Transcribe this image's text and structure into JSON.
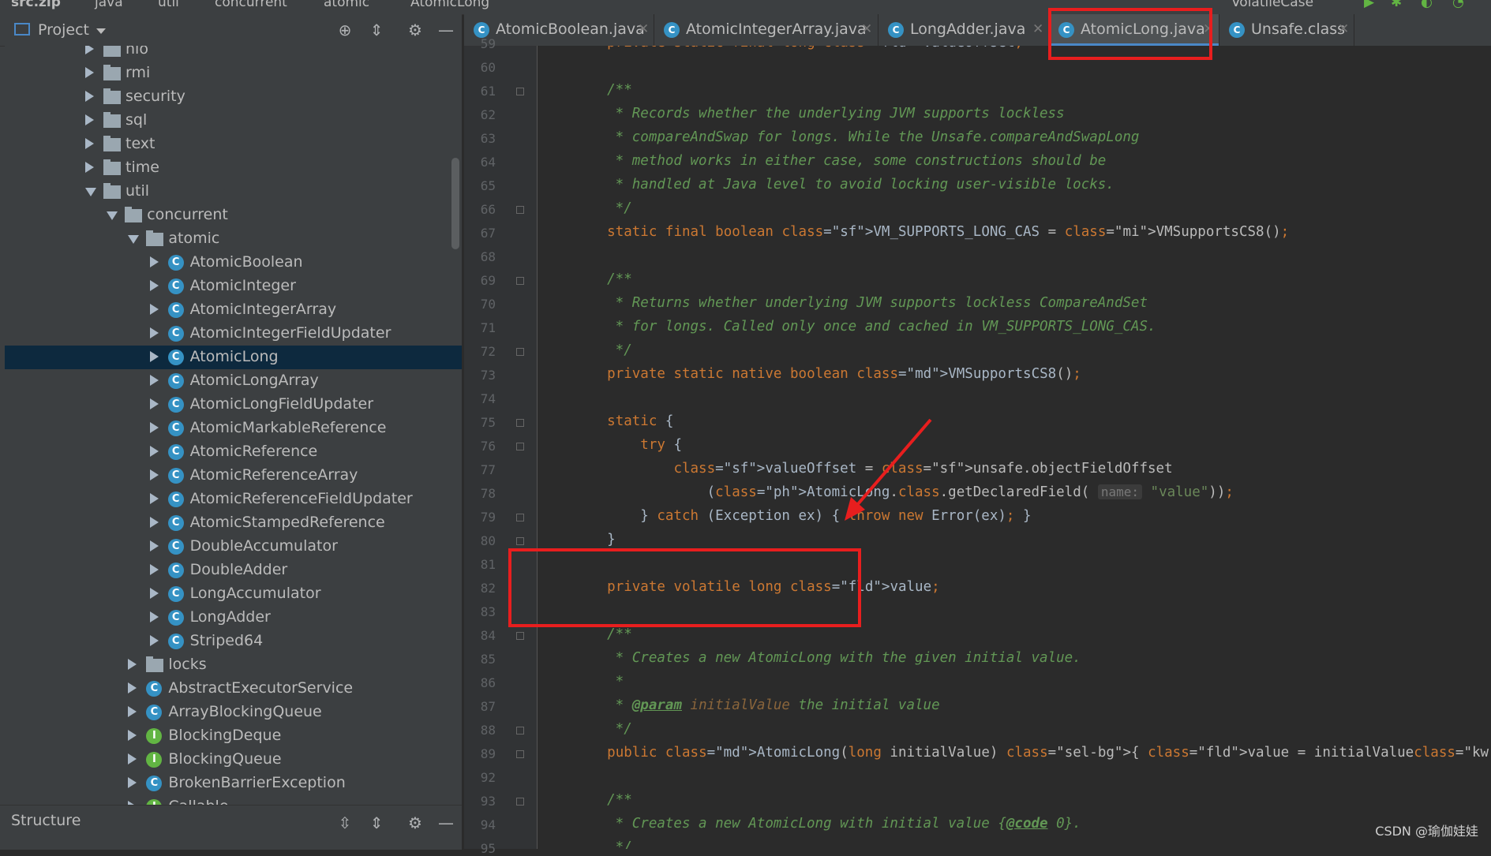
{
  "breadcrumb": [
    "src.zip",
    "java",
    "util",
    "concurrent",
    "atomic",
    "AtomicLong"
  ],
  "run_config": "VolatileCase",
  "project_panel": {
    "title": "Project",
    "tree": [
      {
        "label": "nio",
        "depth": 4,
        "kind": "folder",
        "state": "collapsed"
      },
      {
        "label": "rmi",
        "depth": 4,
        "kind": "folder",
        "state": "collapsed"
      },
      {
        "label": "security",
        "depth": 4,
        "kind": "folder",
        "state": "collapsed"
      },
      {
        "label": "sql",
        "depth": 4,
        "kind": "folder",
        "state": "collapsed"
      },
      {
        "label": "text",
        "depth": 4,
        "kind": "folder",
        "state": "collapsed"
      },
      {
        "label": "time",
        "depth": 4,
        "kind": "folder",
        "state": "collapsed"
      },
      {
        "label": "util",
        "depth": 4,
        "kind": "folder",
        "state": "expanded"
      },
      {
        "label": "concurrent",
        "depth": 5,
        "kind": "folder",
        "state": "expanded"
      },
      {
        "label": "atomic",
        "depth": 6,
        "kind": "folder",
        "state": "expanded"
      },
      {
        "label": "AtomicBoolean",
        "depth": 7,
        "kind": "class",
        "state": "collapsed"
      },
      {
        "label": "AtomicInteger",
        "depth": 7,
        "kind": "class",
        "state": "collapsed"
      },
      {
        "label": "AtomicIntegerArray",
        "depth": 7,
        "kind": "class",
        "state": "collapsed"
      },
      {
        "label": "AtomicIntegerFieldUpdater",
        "depth": 7,
        "kind": "class",
        "state": "collapsed"
      },
      {
        "label": "AtomicLong",
        "depth": 7,
        "kind": "class",
        "state": "collapsed",
        "selected": true
      },
      {
        "label": "AtomicLongArray",
        "depth": 7,
        "kind": "class",
        "state": "collapsed"
      },
      {
        "label": "AtomicLongFieldUpdater",
        "depth": 7,
        "kind": "class",
        "state": "collapsed"
      },
      {
        "label": "AtomicMarkableReference",
        "depth": 7,
        "kind": "class",
        "state": "collapsed"
      },
      {
        "label": "AtomicReference",
        "depth": 7,
        "kind": "class",
        "state": "collapsed"
      },
      {
        "label": "AtomicReferenceArray",
        "depth": 7,
        "kind": "class",
        "state": "collapsed"
      },
      {
        "label": "AtomicReferenceFieldUpdater",
        "depth": 7,
        "kind": "class",
        "state": "collapsed"
      },
      {
        "label": "AtomicStampedReference",
        "depth": 7,
        "kind": "class",
        "state": "collapsed"
      },
      {
        "label": "DoubleAccumulator",
        "depth": 7,
        "kind": "class",
        "state": "collapsed"
      },
      {
        "label": "DoubleAdder",
        "depth": 7,
        "kind": "class",
        "state": "collapsed"
      },
      {
        "label": "LongAccumulator",
        "depth": 7,
        "kind": "class",
        "state": "collapsed"
      },
      {
        "label": "LongAdder",
        "depth": 7,
        "kind": "class",
        "state": "collapsed"
      },
      {
        "label": "Striped64",
        "depth": 7,
        "kind": "class",
        "state": "collapsed"
      },
      {
        "label": "locks",
        "depth": 6,
        "kind": "folder",
        "state": "collapsed"
      },
      {
        "label": "AbstractExecutorService",
        "depth": 6,
        "kind": "class",
        "state": "collapsed"
      },
      {
        "label": "ArrayBlockingQueue",
        "depth": 6,
        "kind": "class",
        "state": "collapsed"
      },
      {
        "label": "BlockingDeque",
        "depth": 6,
        "kind": "interface",
        "state": "collapsed"
      },
      {
        "label": "BlockingQueue",
        "depth": 6,
        "kind": "interface",
        "state": "collapsed"
      },
      {
        "label": "BrokenBarrierException",
        "depth": 6,
        "kind": "class",
        "state": "collapsed"
      },
      {
        "label": "Callable",
        "depth": 6,
        "kind": "interface",
        "state": "collapsed"
      }
    ]
  },
  "structure_panel": {
    "title": "Structure"
  },
  "tabs": [
    {
      "label": "AtomicBoolean.java",
      "active": false
    },
    {
      "label": "AtomicIntegerArray.java",
      "active": false
    },
    {
      "label": "LongAdder.java",
      "active": false
    },
    {
      "label": "AtomicLong.java",
      "active": true
    },
    {
      "label": "Unsafe.class",
      "active": false
    }
  ],
  "editor": {
    "lines": [
      {
        "n": "59",
        "t": "    private static final long valueOffset;"
      },
      {
        "n": "60",
        "t": ""
      },
      {
        "n": "61",
        "t": "    /**"
      },
      {
        "n": "62",
        "t": "     * Records whether the underlying JVM supports lockless"
      },
      {
        "n": "63",
        "t": "     * compareAndSwap for longs. While the Unsafe.compareAndSwapLong"
      },
      {
        "n": "64",
        "t": "     * method works in either case, some constructions should be"
      },
      {
        "n": "65",
        "t": "     * handled at Java level to avoid locking user-visible locks."
      },
      {
        "n": "66",
        "t": "     */"
      },
      {
        "n": "67",
        "t": "    static final boolean VM_SUPPORTS_LONG_CAS = VMSupportsCS8();"
      },
      {
        "n": "68",
        "t": ""
      },
      {
        "n": "69",
        "t": "    /**"
      },
      {
        "n": "70",
        "t": "     * Returns whether underlying JVM supports lockless CompareAndSet"
      },
      {
        "n": "71",
        "t": "     * for longs. Called only once and cached in VM_SUPPORTS_LONG_CAS."
      },
      {
        "n": "72",
        "t": "     */"
      },
      {
        "n": "73",
        "t": "    private static native boolean VMSupportsCS8();"
      },
      {
        "n": "74",
        "t": ""
      },
      {
        "n": "75",
        "t": "    static {"
      },
      {
        "n": "76",
        "t": "        try {"
      },
      {
        "n": "77",
        "t": "            valueOffset = unsafe.objectFieldOffset"
      },
      {
        "n": "78",
        "t": "                (AtomicLong.class.getDeclaredField( name: \"value\"));"
      },
      {
        "n": "79",
        "t": "        } catch (Exception ex) { throw new Error(ex); }"
      },
      {
        "n": "80",
        "t": "    }"
      },
      {
        "n": "81",
        "t": ""
      },
      {
        "n": "82",
        "t": "    private volatile long value;"
      },
      {
        "n": "83",
        "t": ""
      },
      {
        "n": "84",
        "t": "    /**"
      },
      {
        "n": "85",
        "t": "     * Creates a new AtomicLong with the given initial value."
      },
      {
        "n": "86",
        "t": "     *"
      },
      {
        "n": "87",
        "t": "     * @param initialValue the initial value"
      },
      {
        "n": "88",
        "t": "     */"
      },
      {
        "n": "89",
        "t": "    public AtomicLong(long initialValue) { value = initialValue; }"
      },
      {
        "n": "92",
        "t": ""
      },
      {
        "n": "93",
        "t": "    /**"
      },
      {
        "n": "94",
        "t": "     * Creates a new AtomicLong with initial value {@code 0}."
      },
      {
        "n": "95",
        "t": "     */"
      }
    ]
  },
  "watermark": "CSDN @瑜伽娃娃",
  "colors": {
    "annotation_red": "#e81e1e",
    "selection": "#0d293e",
    "tab_underline": "#4a88c7"
  }
}
